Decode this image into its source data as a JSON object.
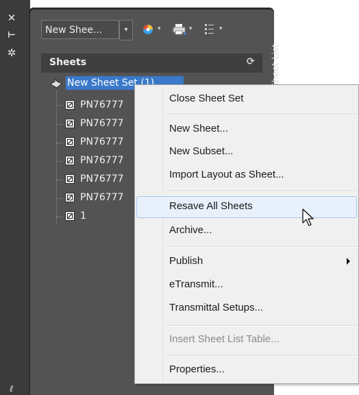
{
  "left_strip": {
    "tools": [
      {
        "name": "close-icon",
        "glyph": "✕"
      },
      {
        "name": "auto-hide-icon",
        "glyph": "⊢"
      },
      {
        "name": "settings-icon",
        "glyph": "✲"
      }
    ],
    "bottom_glyph": "ℓ"
  },
  "toolbar": {
    "combo_value": "New Shee...",
    "combo_arrow": "▾",
    "icons": [
      {
        "name": "sheet-set-view-icon"
      },
      {
        "name": "publish-plot-icon"
      },
      {
        "name": "sheet-list-options-icon"
      }
    ],
    "dropdown_glyph": "▾"
  },
  "panel": {
    "title": "Sheets",
    "refresh_glyph": "⟳",
    "vertical_tab": "Sheet List"
  },
  "tree": {
    "root_label": "New Sheet Set (1)",
    "children": [
      "PN76777",
      "PN76777",
      "PN76777",
      "PN76777",
      "PN76777",
      "PN76777",
      "1"
    ]
  },
  "context_menu": {
    "items": [
      {
        "label": "Close Sheet Set",
        "enabled": true
      },
      {
        "label": "New Sheet...",
        "enabled": true
      },
      {
        "label": "New Subset...",
        "enabled": true
      },
      {
        "label": "Import Layout as Sheet...",
        "enabled": true
      },
      {
        "label": "Resave All Sheets",
        "enabled": true,
        "hovered": true
      },
      {
        "label": "Archive...",
        "enabled": true
      },
      {
        "label": "Publish",
        "enabled": true,
        "submenu": true
      },
      {
        "label": "eTransmit...",
        "enabled": true
      },
      {
        "label": "Transmittal Setups...",
        "enabled": true
      },
      {
        "label": "Insert Sheet List Table...",
        "enabled": false
      },
      {
        "label": "Properties...",
        "enabled": true
      }
    ]
  },
  "colors": {
    "palette_bg": "#535353",
    "header_bg": "#3f3f3f",
    "selection": "#3a79c9",
    "menu_bg": "#f0f0f0",
    "menu_hover": "#e7f0fb"
  }
}
